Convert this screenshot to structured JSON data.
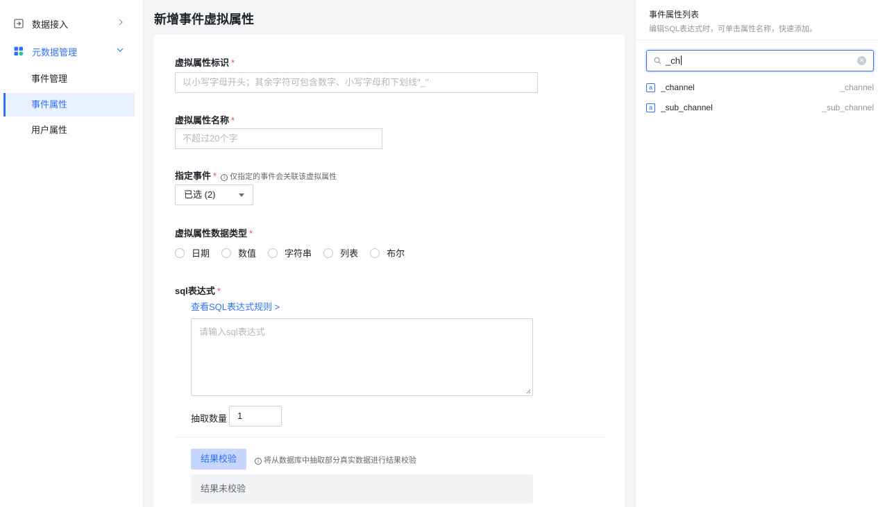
{
  "sidebar": {
    "groups": [
      {
        "label": "数据接入",
        "icon": "login-icon",
        "expanded": false
      },
      {
        "label": "元数据管理",
        "icon": "metadata-icon",
        "expanded": true
      }
    ],
    "sub_items": [
      {
        "label": "事件管理",
        "active": false
      },
      {
        "label": "事件属性",
        "active": true
      },
      {
        "label": "用户属性",
        "active": false
      }
    ]
  },
  "main": {
    "title": "新增事件虚拟属性",
    "form": {
      "identifier_label": "虚拟属性标识",
      "identifier_placeholder": "以小写字母开头；其余字符可包含数字、小写字母和下划线\"_\"",
      "name_label": "虚拟属性名称",
      "name_placeholder": "不超过20个字",
      "event_label": "指定事件",
      "event_hint": "仅指定的事件会关联该虚拟属性",
      "event_selected": "已选 (2)",
      "datatype_label": "虚拟属性数据类型",
      "datatype_options": [
        "日期",
        "数值",
        "字符串",
        "列表",
        "布尔"
      ],
      "sql_label": "sql表达式",
      "sql_rules_link": "查看SQL表达式规则 >",
      "sql_placeholder": "请输入sql表达式",
      "sample_label": "抽取数量",
      "sample_value": "1",
      "verify_button": "结果校验",
      "verify_hint": "将从数据库中抽取部分真实数据进行结果校验",
      "verify_result": "结果未校验",
      "required_mark": "*"
    }
  },
  "right_panel": {
    "title": "事件属性列表",
    "subtitle": "编辑SQL表达式时，可单击属性名称，快速添加。",
    "search_value": "_ch",
    "results": [
      {
        "name": "_channel",
        "id": "_channel",
        "type_badge": "a"
      },
      {
        "name": "_sub_channel",
        "id": "_sub_channel",
        "type_badge": "a"
      }
    ]
  },
  "colors": {
    "accent": "#3370ff",
    "required": "#f54a45",
    "active_bg": "#eaf1ff"
  }
}
